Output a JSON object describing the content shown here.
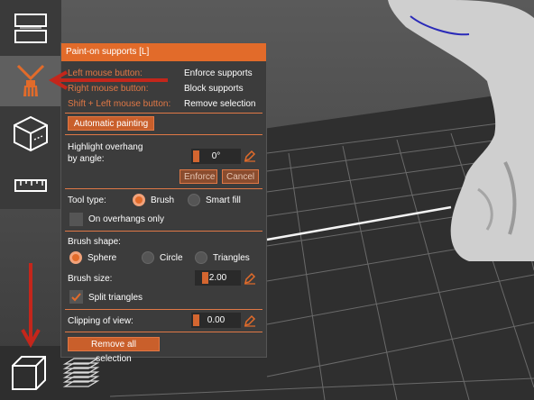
{
  "panel": {
    "title": "Paint-on supports [L]",
    "hints": [
      {
        "key": "Left mouse button:",
        "action": "Enforce supports"
      },
      {
        "key": "Right mouse button:",
        "action": "Block supports"
      },
      {
        "key": "Shift + Left mouse button:",
        "action": "Remove selection"
      }
    ],
    "automatic_painting_label": "Automatic painting",
    "highlight_label_line1": "Highlight overhang",
    "highlight_label_line2": "by angle:",
    "angle_value": "0°",
    "enforce_label": "Enforce",
    "cancel_label": "Cancel",
    "tool_type_label": "Tool type:",
    "tool_brush_label": "Brush",
    "tool_smartfill_label": "Smart fill",
    "overhangs_only_label": "On overhangs only",
    "brush_shape_label": "Brush shape:",
    "shape_sphere_label": "Sphere",
    "shape_circle_label": "Circle",
    "shape_triangles_label": "Triangles",
    "brush_size_label": "Brush size:",
    "brush_size_value": "2.00",
    "split_triangles_label": "Split triangles",
    "clipping_label": "Clipping of view:",
    "clipping_value": "0.00",
    "remove_all_label": "Remove all selection"
  },
  "colors": {
    "accent": "#e26b2a",
    "panel_bg": "#3c3c3c",
    "viewport_bg": "#4a4a4a",
    "annotation_arrow": "#c4261b"
  },
  "toolbar": {
    "icons": [
      "layout-icon",
      "paint-supports-icon",
      "cube-measure-icon",
      "ruler-icon"
    ],
    "active": "paint-supports-icon"
  },
  "bottom_bar": {
    "icons": [
      "3d-view-cube-icon",
      "layers-view-icon"
    ]
  }
}
